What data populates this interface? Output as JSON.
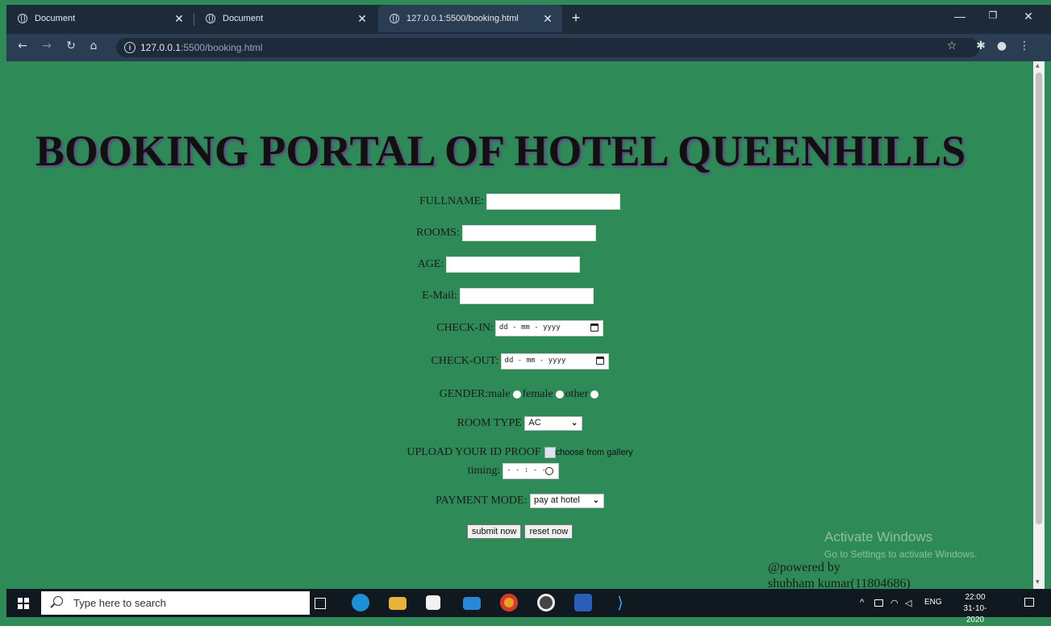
{
  "browser": {
    "tabs": [
      {
        "title": "Document"
      },
      {
        "title": "Document"
      },
      {
        "title": "127.0.0.1:5500/booking.html"
      }
    ],
    "new_tab_label": "+",
    "url_host": "127.0.0.1",
    "url_rest": ":5500/booking.html"
  },
  "page": {
    "title": "BOOKING PORTAL OF HOTEL QUEENHILLS",
    "fullname_label": "FULLNAME:",
    "rooms_label": "ROOMS:",
    "age_label": "AGE:",
    "email_label": "E-Mail:",
    "checkin_label": "CHECK-IN:",
    "checkout_label": "CHECK-OUT:",
    "date_placeholder": "dd - mm - yyyy",
    "gender_label": "GENDER:",
    "gender_options": [
      "male",
      "female",
      "other"
    ],
    "roomtype_label": "ROOM TYPE",
    "roomtype_value": "AC",
    "upload_label": "UPLOAD YOUR ID PROOF",
    "upload_option": "choose from gallery",
    "timing_label": "timing:",
    "time_placeholder": "- - : - -",
    "payment_label": "PAYMENT MODE:",
    "payment_value": "pay at hotel",
    "submit_label": "submit now",
    "reset_label": "reset now",
    "powered_line1": "@powered by",
    "powered_line2": "shubham kumar(11804686)"
  },
  "watermark": {
    "line1": "Activate Windows",
    "line2": "Go to Settings to activate Windows."
  },
  "taskbar": {
    "search_placeholder": "Type here to search",
    "language": "ENG",
    "time": "22:00",
    "date": "31-10-2020"
  }
}
